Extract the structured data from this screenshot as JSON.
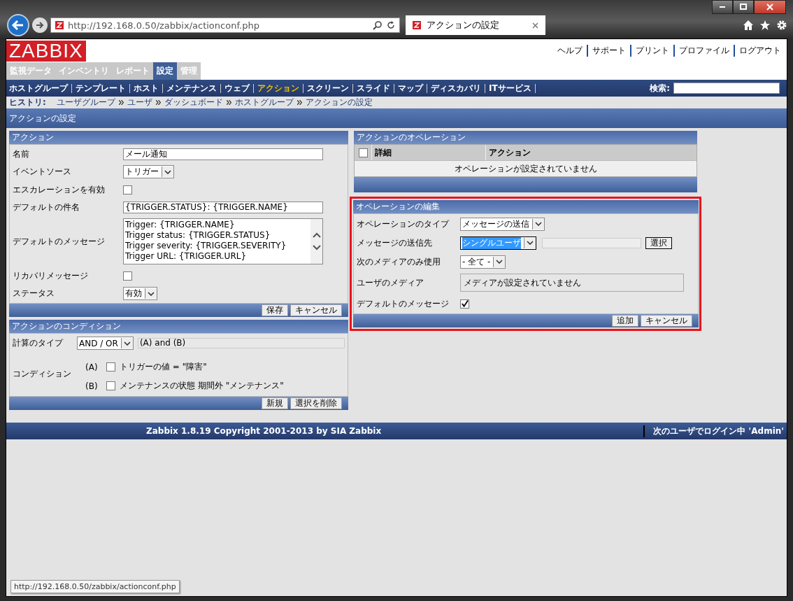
{
  "browser": {
    "address": "http://192.168.0.50/zabbix/actionconf.php",
    "tab_title": "アクションの設定"
  },
  "header": {
    "logo": "ZABBIX",
    "links": [
      "ヘルプ",
      "サポート",
      "プリント",
      "プロファイル",
      "ログアウト"
    ]
  },
  "main_tabs": [
    {
      "label": "監視データ",
      "selected": false
    },
    {
      "label": "インベントリ",
      "selected": false
    },
    {
      "label": "レポート",
      "selected": false
    },
    {
      "label": "設定",
      "selected": true
    },
    {
      "label": "管理",
      "selected": false
    }
  ],
  "sub_nav": [
    {
      "label": "ホストグループ",
      "selected": false
    },
    {
      "label": "テンプレート",
      "selected": false
    },
    {
      "label": "ホスト",
      "selected": false
    },
    {
      "label": "メンテナンス",
      "selected": false
    },
    {
      "label": "ウェブ",
      "selected": false
    },
    {
      "label": "アクション",
      "selected": true
    },
    {
      "label": "スクリーン",
      "selected": false
    },
    {
      "label": "スライド",
      "selected": false
    },
    {
      "label": "マップ",
      "selected": false
    },
    {
      "label": "ディスカバリ",
      "selected": false
    },
    {
      "label": "ITサービス",
      "selected": false
    }
  ],
  "search": {
    "label": "検索:"
  },
  "history": {
    "label": "ヒストリ:",
    "items": [
      "ユーザグループ",
      "ユーザ",
      "ダッシュボード",
      "ホストグループ",
      "アクションの設定"
    ]
  },
  "page_title": "アクションの設定",
  "action_form": {
    "title": "アクション",
    "rows": [
      {
        "kind": "text",
        "label": "名前",
        "value": "メール通知"
      },
      {
        "kind": "select",
        "label": "イベントソース",
        "value": "トリガー"
      },
      {
        "kind": "checkbox",
        "label": "エスカレーションを有効",
        "checked": false
      },
      {
        "kind": "text",
        "label": "デフォルトの件名",
        "value": "{TRIGGER.STATUS}: {TRIGGER.NAME}"
      },
      {
        "kind": "textarea",
        "label": "デフォルトのメッセージ",
        "lines": [
          "Trigger: {TRIGGER.NAME}",
          "Trigger status: {TRIGGER.STATUS}",
          "Trigger severity: {TRIGGER.SEVERITY}",
          "Trigger URL: {TRIGGER.URL}"
        ]
      },
      {
        "kind": "checkbox",
        "label": "リカバリメッセージ",
        "checked": false
      },
      {
        "kind": "select",
        "label": "ステータス",
        "value": "有効"
      }
    ],
    "buttons": [
      "保存",
      "キャンセル"
    ]
  },
  "conditions": {
    "title": "アクションのコンディション",
    "calc_label": "計算のタイプ",
    "calc_type": "AND / OR",
    "formula": "(A) and (B)",
    "condition_label": "コンディション",
    "items": [
      {
        "tag": "(A)",
        "text": "トリガーの値 = \"障害\"",
        "checked": false
      },
      {
        "tag": "(B)",
        "text": "メンテナンスの状態 期間外 \"メンテナンス\"",
        "checked": false
      }
    ],
    "buttons": [
      "新規",
      "選択を削除"
    ]
  },
  "operations": {
    "title": "アクションのオペレーション",
    "all_checked": false,
    "columns": [
      "詳細",
      "アクション"
    ],
    "empty": "オペレーションが設定されていません"
  },
  "operation_edit": {
    "title": "オペレーションの編集",
    "rows": [
      {
        "kind": "select",
        "label": "オペレーションのタイプ",
        "value": "メッセージの送信"
      },
      {
        "kind": "select_pick",
        "label": "メッセージの送信先",
        "value": "シングルユーザ",
        "button": "選択"
      },
      {
        "kind": "select",
        "label": "次のメディアのみ使用",
        "value": "- 全て -"
      },
      {
        "kind": "info",
        "label": "ユーザのメディア",
        "value": "メディアが設定されていません"
      },
      {
        "kind": "checkbox",
        "label": "デフォルトのメッセージ",
        "checked": true
      }
    ],
    "buttons": [
      "追加",
      "キャンセル"
    ]
  },
  "footer": {
    "copyright": "Zabbix 1.8.19 Copyright 2001-2013 by SIA Zabbix",
    "login": "次のユーザでログイン中 'Admin'"
  },
  "status_url": "http://192.168.0.50/zabbix/actionconf.php"
}
